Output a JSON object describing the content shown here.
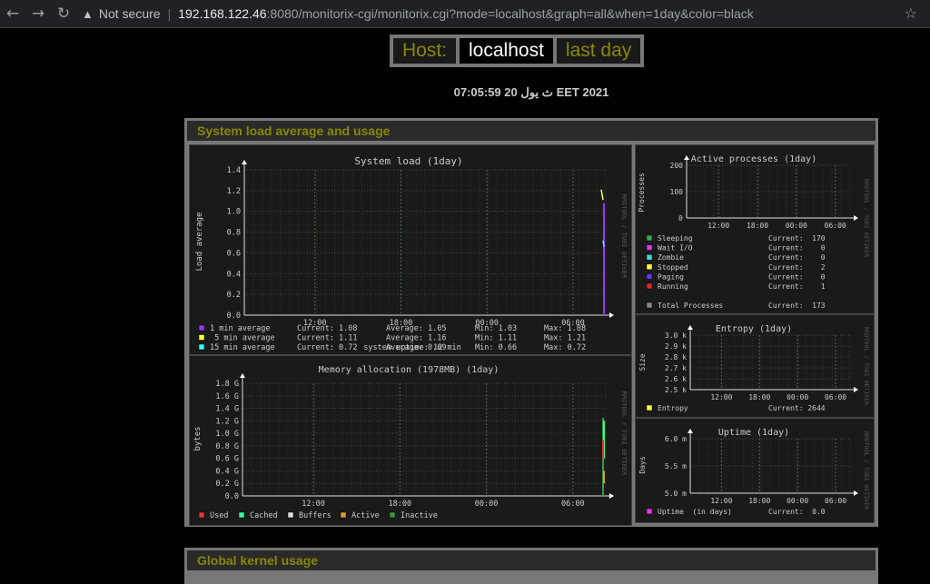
{
  "browser": {
    "back_icon": "arrow-left-icon",
    "forward_icon": "arrow-right-icon",
    "reload_icon": "reload-icon",
    "security": "Not secure",
    "url_host": "192.168.122.46",
    "url_path": ":8080/monitorix-cgi/monitorix.cgi?mode=localhost&graph=all&when=1day&color=black",
    "star_icon": "star-icon"
  },
  "header": {
    "host_label": "Host:",
    "host_value": "localhost",
    "period": "last day",
    "datetime": "07:05:59 20 ث يول EET 2021"
  },
  "sections": {
    "system_title": "System load average and usage",
    "kernel_title": "Global kernel usage"
  },
  "load": {
    "title": "System load  (1day)",
    "ylabel": "Load average",
    "yticks": [
      "1.4",
      "1.2",
      "1.0",
      "0.8",
      "0.6",
      "0.4",
      "0.2",
      "0.0"
    ],
    "xticks": [
      "12:00",
      "18:00",
      "00:00",
      "06:00"
    ],
    "legend": [
      {
        "color": "#9933ff",
        "name": "1 min average",
        "current": "Current: 1.08",
        "average": "Average: 1.05",
        "min": "Min: 1.03",
        "max": "Max: 1.08"
      },
      {
        "color": "#ffff33",
        "name": " 5 min average",
        "current": "Current: 1.11",
        "average": "Average: 1.16",
        "min": "Min: 1.11",
        "max": "Max: 1.21"
      },
      {
        "color": "#33ffff",
        "name": "15 min average",
        "current": "Current: 0.72",
        "average": "Average: 0.69",
        "min": "Min: 0.66",
        "max": "Max: 0.72"
      }
    ],
    "uptime": "system uptime:  12 min",
    "side": "RRDTOOL / TOBI OETIKER"
  },
  "memory": {
    "title": "Memory allocation (1978MB)  (1day)",
    "ylabel": "bytes",
    "yticks": [
      "1.8 G",
      "1.6 G",
      "1.4 G",
      "1.2 G",
      "1.0 G",
      "0.8 G",
      "0.6 G",
      "0.4 G",
      "0.2 G",
      "0.0"
    ],
    "xticks": [
      "12:00",
      "18:00",
      "00:00",
      "06:00"
    ],
    "legend": [
      {
        "color": "#ee3333",
        "name": "Used"
      },
      {
        "color": "#33ff99",
        "name": "Cached"
      },
      {
        "color": "#dddddd",
        "name": "Buffers"
      },
      {
        "color": "#dd9933",
        "name": "Active"
      },
      {
        "color": "#339944",
        "name": "Inactive"
      }
    ],
    "side": "RRDTOOL / TOBI OETIKER"
  },
  "processes": {
    "title": "Active processes  (1day)",
    "ylabel": "Processes",
    "yticks": [
      "200",
      "100",
      "0"
    ],
    "xticks": [
      "12:00",
      "18:00",
      "00:00",
      "06:00"
    ],
    "legend": [
      {
        "color": "#33aa55",
        "name": "Sleeping",
        "current": "Current:  170"
      },
      {
        "color": "#ee33ee",
        "name": "Wait I/O",
        "current": "Current:    0"
      },
      {
        "color": "#33dddd",
        "name": "Zombie",
        "current": "Current:    0"
      },
      {
        "color": "#ffff33",
        "name": "Stopped",
        "current": "Current:    2"
      },
      {
        "color": "#6633ff",
        "name": "Paging",
        "current": "Current:    0"
      },
      {
        "color": "#ee2222",
        "name": "Running",
        "current": "Current:    1"
      }
    ],
    "total": {
      "color": "#888888",
      "name": "Total Processes",
      "current": "Current:  173"
    },
    "side": "RRDTOOL / TOBI OETIKER"
  },
  "entropy": {
    "title": "Entropy  (1day)",
    "ylabel": "Size",
    "yticks": [
      "3.0 k",
      "2.9 k",
      "2.8 k",
      "2.7 k",
      "2.6 k",
      "2.5 k"
    ],
    "xticks": [
      "12:00",
      "18:00",
      "00:00",
      "06:00"
    ],
    "legend": {
      "color": "#ffff33",
      "name": "Entropy",
      "current": "Current: 2644"
    },
    "side": "RRDTOOL / TOBI OETIKER"
  },
  "uptime": {
    "title": "Uptime  (1day)",
    "ylabel": "Days",
    "yticks": [
      "6.0 m",
      "5.5 m",
      "5.0 m"
    ],
    "xticks": [
      "12:00",
      "18:00",
      "00:00",
      "06:00"
    ],
    "legend": {
      "color": "#ee33ee",
      "name": "Uptime  (in days)",
      "current": "Current:  0.0"
    },
    "side": "RRDTOOL / TOBI OETIKER"
  }
}
